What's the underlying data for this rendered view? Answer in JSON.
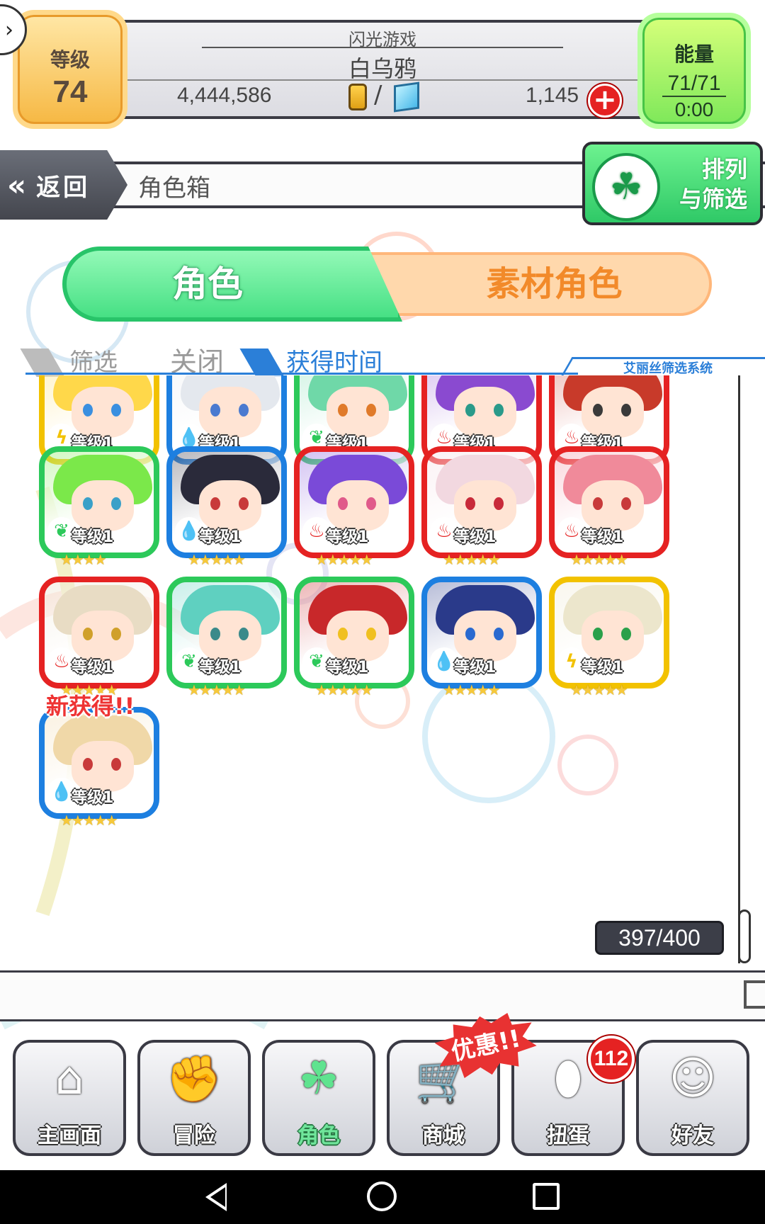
{
  "header": {
    "level_label": "等级",
    "level_value": "74",
    "game_name": "闪光游戏",
    "player_name": "白乌鸦",
    "gold_amount": "4,444,586",
    "currency_separator": "/",
    "gem_amount": "1,145",
    "energy_label": "能量",
    "energy_value": "71/71",
    "energy_timer": "0:00",
    "nav_toggle_icon": "chevron-right-icon",
    "plus_icon": "plus-icon"
  },
  "title_bar": {
    "back_label": "返回",
    "page_title": "角色箱",
    "sort_label_line1": "排列",
    "sort_label_line2": "与筛选"
  },
  "tabs": {
    "characters": "角色",
    "material": "素材角色"
  },
  "filter": {
    "filter_label": "筛选",
    "filter_state": "关闭",
    "sort_order": "获得时间",
    "system_label": "艾丽丝筛选系统"
  },
  "colors": {
    "thunder": "#f2c200",
    "water": "#1d7fe0",
    "wood": "#2cc95a",
    "fire": "#e52222"
  },
  "characters": [
    {
      "element": "thunder",
      "level": "等级1",
      "stars": "★★★★",
      "hair": "#ffd84a",
      "eye": "#3a8fe0"
    },
    {
      "element": "water",
      "level": "等级1",
      "stars": "★★★★★",
      "hair": "#e4e8ee",
      "eye": "#4a7ad0"
    },
    {
      "element": "wood",
      "level": "等级1",
      "stars": "★★★★",
      "hair": "#6fd8a8",
      "eye": "#e07a2a"
    },
    {
      "element": "fire",
      "level": "等级1",
      "stars": "★★★★",
      "hair": "#8a4ad0",
      "eye": "#2a9a8a"
    },
    {
      "element": "fire",
      "level": "等级1",
      "stars": "★★★★",
      "hair": "#c83a2a",
      "eye": "#3a3a3a"
    },
    {
      "element": "wood",
      "level": "等级1",
      "stars": "★★★★",
      "hair": "#7be84a",
      "eye": "#3aa0c8"
    },
    {
      "element": "water",
      "level": "等级1",
      "stars": "★★★★★",
      "hair": "#2a2a3a",
      "eye": "#c83a3a"
    },
    {
      "element": "fire",
      "level": "等级1",
      "stars": "★★★★★",
      "hair": "#7a4ad8",
      "eye": "#e05a8a"
    },
    {
      "element": "fire",
      "level": "等级1",
      "stars": "★★★★★",
      "hair": "#f2d8e0",
      "eye": "#c82a3a"
    },
    {
      "element": "fire",
      "level": "等级1",
      "stars": "★★★★★",
      "hair": "#f08a9a",
      "eye": "#c83a3a"
    },
    {
      "element": "fire",
      "level": "等级1",
      "stars": "★★★★★",
      "hair": "#e8dcc4",
      "eye": "#d0a02a"
    },
    {
      "element": "wood",
      "level": "等级1",
      "stars": "★★★★★",
      "hair": "#5fd0c0",
      "eye": "#3a8a8a"
    },
    {
      "element": "wood",
      "level": "等级1",
      "stars": "★★★★★",
      "hair": "#c8282a",
      "eye": "#f0c020"
    },
    {
      "element": "water",
      "level": "等级1",
      "stars": "★★★★★",
      "hair": "#2a3a8a",
      "eye": "#2a6ad0"
    },
    {
      "element": "thunder",
      "level": "等级1",
      "stars": "★★★★★",
      "hair": "#ece6cc",
      "eye": "#2aa04a"
    },
    {
      "element": "water",
      "level": "等级1",
      "stars": "★★★★★",
      "hair": "#f0d8a8",
      "eye": "#c83a3a",
      "badge": "新获得!!"
    }
  ],
  "element_icons": {
    "thunder": "ϟ",
    "water": "💧",
    "wood": "❦",
    "fire": "♨"
  },
  "box_count": "397/400",
  "bottom_nav": [
    {
      "label": "主画面",
      "icon": "home-icon",
      "glyph": "⌂"
    },
    {
      "label": "冒险",
      "icon": "handshake-icon",
      "glyph": "✊"
    },
    {
      "label": "角色",
      "icon": "rabbit-icon",
      "glyph": "☘",
      "active": true
    },
    {
      "label": "商城",
      "icon": "cart-icon",
      "glyph": "🛒"
    },
    {
      "label": "扭蛋",
      "icon": "egg-icon",
      "glyph": "⬮"
    },
    {
      "label": "好友",
      "icon": "friends-icon",
      "glyph": "☺"
    }
  ],
  "promo_label": "优惠!!",
  "gacha_count": "112"
}
